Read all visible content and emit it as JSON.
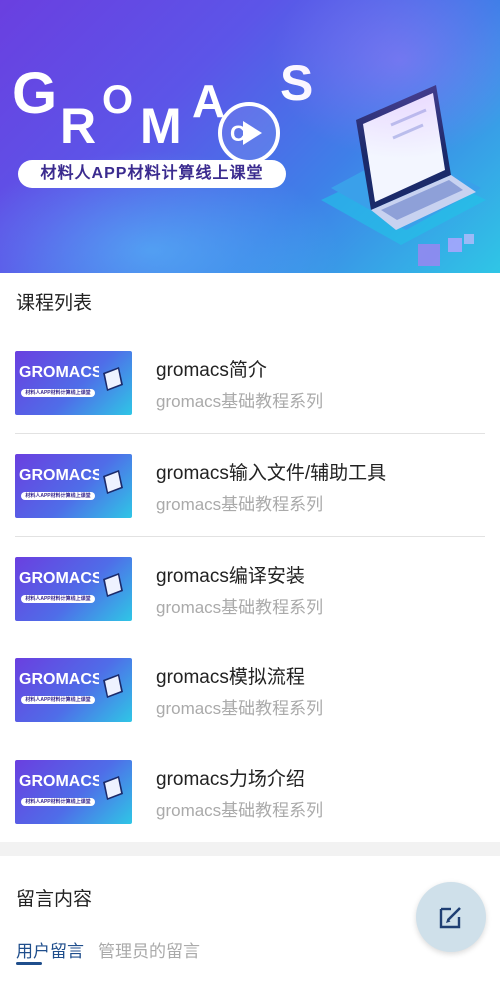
{
  "banner": {
    "logo_text": "GROMACS",
    "tagline": "材料人APP材料计算线上课堂"
  },
  "course_list": {
    "title": "课程列表",
    "items": [
      {
        "title": "gromacs简介",
        "subtitle": "gromacs基础教程系列"
      },
      {
        "title": "gromacs输入文件/辅助工具",
        "subtitle": "gromacs基础教程系列"
      },
      {
        "title": "gromacs编译安装",
        "subtitle": "gromacs基础教程系列"
      },
      {
        "title": "gromacs模拟流程",
        "subtitle": "gromacs基础教程系列"
      },
      {
        "title": "gromacs力场介绍",
        "subtitle": "gromacs基础教程系列"
      }
    ],
    "thumbnail_tagline": "材料人APP材料计算线上课堂"
  },
  "comments": {
    "title": "留言内容",
    "tabs": [
      {
        "label": "用户留言",
        "active": true
      },
      {
        "label": "管理员的留言",
        "active": false
      }
    ],
    "fab_icon": "edit-icon"
  },
  "colors": {
    "accent": "#1f4e8c",
    "fab_bg": "#cfe0ea",
    "muted": "#aaaaaa"
  }
}
